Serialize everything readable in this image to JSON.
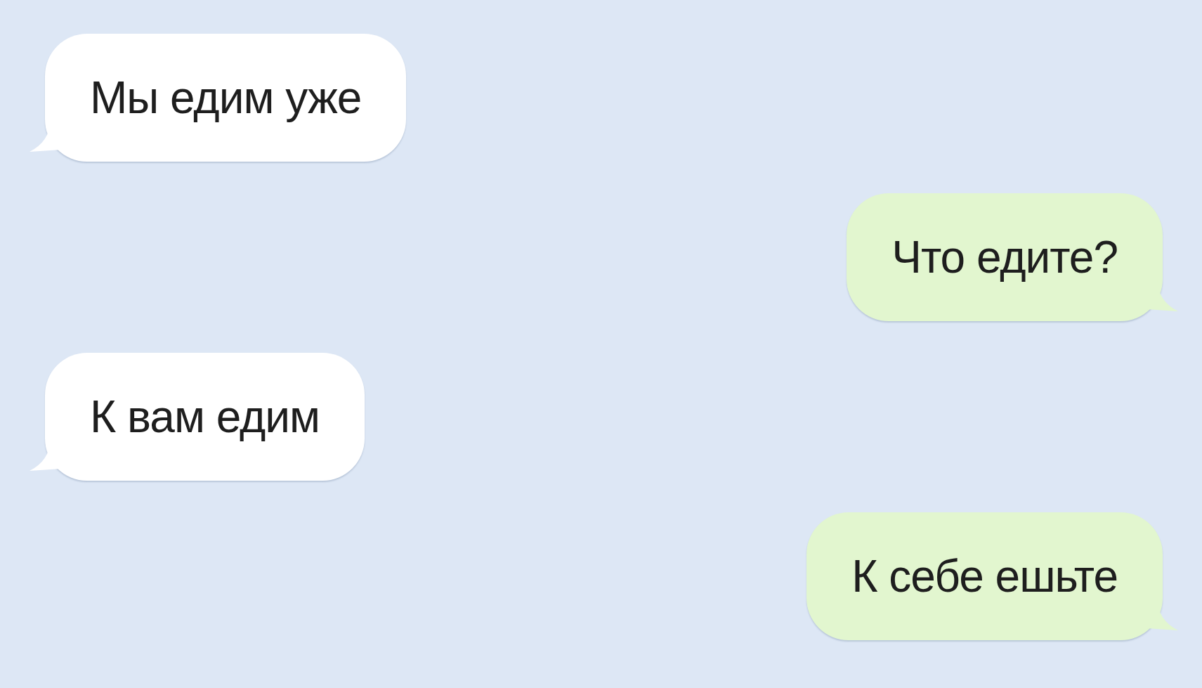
{
  "messages": [
    {
      "kind": "incoming",
      "text": "Мы едим уже"
    },
    {
      "kind": "outgoing",
      "text": "Что едите?"
    },
    {
      "kind": "incoming",
      "text": "К вам едим"
    },
    {
      "kind": "outgoing",
      "text": "К себе ешьте"
    }
  ]
}
